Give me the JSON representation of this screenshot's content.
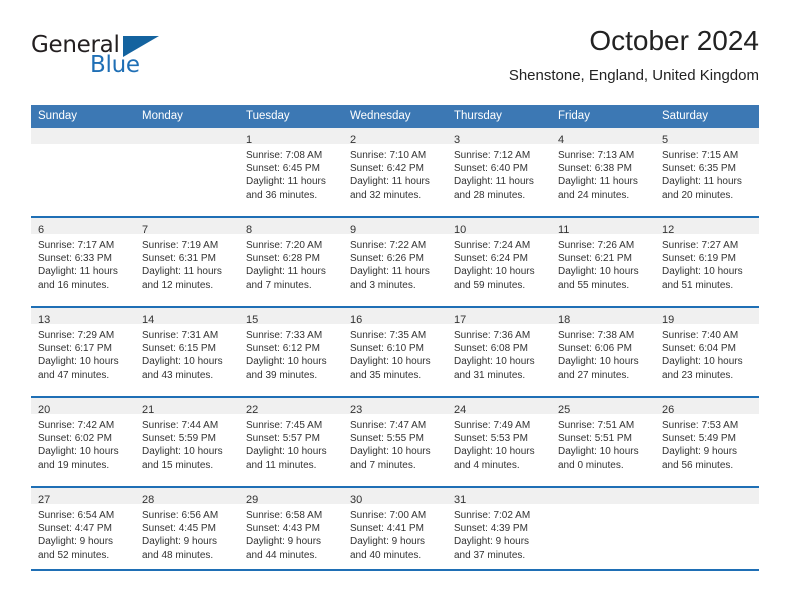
{
  "brand": {
    "name_part1": "General",
    "name_part2": "Blue",
    "flag_icon": "triangle-flag-icon",
    "accent_color": "#1f6fb5"
  },
  "header": {
    "title": "October 2024",
    "location": "Shenstone, England, United Kingdom"
  },
  "colors": {
    "header_row_bg": "#3c78b4",
    "daynum_band_bg": "#f0f0f0",
    "separator": "#1f6fb5",
    "text": "#333333"
  },
  "weekday_headers": [
    "Sunday",
    "Monday",
    "Tuesday",
    "Wednesday",
    "Thursday",
    "Friday",
    "Saturday"
  ],
  "weeks": [
    [
      {
        "day": "",
        "lines": []
      },
      {
        "day": "",
        "lines": []
      },
      {
        "day": "1",
        "lines": [
          "Sunrise: 7:08 AM",
          "Sunset: 6:45 PM",
          "Daylight: 11 hours",
          "and 36 minutes."
        ]
      },
      {
        "day": "2",
        "lines": [
          "Sunrise: 7:10 AM",
          "Sunset: 6:42 PM",
          "Daylight: 11 hours",
          "and 32 minutes."
        ]
      },
      {
        "day": "3",
        "lines": [
          "Sunrise: 7:12 AM",
          "Sunset: 6:40 PM",
          "Daylight: 11 hours",
          "and 28 minutes."
        ]
      },
      {
        "day": "4",
        "lines": [
          "Sunrise: 7:13 AM",
          "Sunset: 6:38 PM",
          "Daylight: 11 hours",
          "and 24 minutes."
        ]
      },
      {
        "day": "5",
        "lines": [
          "Sunrise: 7:15 AM",
          "Sunset: 6:35 PM",
          "Daylight: 11 hours",
          "and 20 minutes."
        ]
      }
    ],
    [
      {
        "day": "6",
        "lines": [
          "Sunrise: 7:17 AM",
          "Sunset: 6:33 PM",
          "Daylight: 11 hours",
          "and 16 minutes."
        ]
      },
      {
        "day": "7",
        "lines": [
          "Sunrise: 7:19 AM",
          "Sunset: 6:31 PM",
          "Daylight: 11 hours",
          "and 12 minutes."
        ]
      },
      {
        "day": "8",
        "lines": [
          "Sunrise: 7:20 AM",
          "Sunset: 6:28 PM",
          "Daylight: 11 hours",
          "and 7 minutes."
        ]
      },
      {
        "day": "9",
        "lines": [
          "Sunrise: 7:22 AM",
          "Sunset: 6:26 PM",
          "Daylight: 11 hours",
          "and 3 minutes."
        ]
      },
      {
        "day": "10",
        "lines": [
          "Sunrise: 7:24 AM",
          "Sunset: 6:24 PM",
          "Daylight: 10 hours",
          "and 59 minutes."
        ]
      },
      {
        "day": "11",
        "lines": [
          "Sunrise: 7:26 AM",
          "Sunset: 6:21 PM",
          "Daylight: 10 hours",
          "and 55 minutes."
        ]
      },
      {
        "day": "12",
        "lines": [
          "Sunrise: 7:27 AM",
          "Sunset: 6:19 PM",
          "Daylight: 10 hours",
          "and 51 minutes."
        ]
      }
    ],
    [
      {
        "day": "13",
        "lines": [
          "Sunrise: 7:29 AM",
          "Sunset: 6:17 PM",
          "Daylight: 10 hours",
          "and 47 minutes."
        ]
      },
      {
        "day": "14",
        "lines": [
          "Sunrise: 7:31 AM",
          "Sunset: 6:15 PM",
          "Daylight: 10 hours",
          "and 43 minutes."
        ]
      },
      {
        "day": "15",
        "lines": [
          "Sunrise: 7:33 AM",
          "Sunset: 6:12 PM",
          "Daylight: 10 hours",
          "and 39 minutes."
        ]
      },
      {
        "day": "16",
        "lines": [
          "Sunrise: 7:35 AM",
          "Sunset: 6:10 PM",
          "Daylight: 10 hours",
          "and 35 minutes."
        ]
      },
      {
        "day": "17",
        "lines": [
          "Sunrise: 7:36 AM",
          "Sunset: 6:08 PM",
          "Daylight: 10 hours",
          "and 31 minutes."
        ]
      },
      {
        "day": "18",
        "lines": [
          "Sunrise: 7:38 AM",
          "Sunset: 6:06 PM",
          "Daylight: 10 hours",
          "and 27 minutes."
        ]
      },
      {
        "day": "19",
        "lines": [
          "Sunrise: 7:40 AM",
          "Sunset: 6:04 PM",
          "Daylight: 10 hours",
          "and 23 minutes."
        ]
      }
    ],
    [
      {
        "day": "20",
        "lines": [
          "Sunrise: 7:42 AM",
          "Sunset: 6:02 PM",
          "Daylight: 10 hours",
          "and 19 minutes."
        ]
      },
      {
        "day": "21",
        "lines": [
          "Sunrise: 7:44 AM",
          "Sunset: 5:59 PM",
          "Daylight: 10 hours",
          "and 15 minutes."
        ]
      },
      {
        "day": "22",
        "lines": [
          "Sunrise: 7:45 AM",
          "Sunset: 5:57 PM",
          "Daylight: 10 hours",
          "and 11 minutes."
        ]
      },
      {
        "day": "23",
        "lines": [
          "Sunrise: 7:47 AM",
          "Sunset: 5:55 PM",
          "Daylight: 10 hours",
          "and 7 minutes."
        ]
      },
      {
        "day": "24",
        "lines": [
          "Sunrise: 7:49 AM",
          "Sunset: 5:53 PM",
          "Daylight: 10 hours",
          "and 4 minutes."
        ]
      },
      {
        "day": "25",
        "lines": [
          "Sunrise: 7:51 AM",
          "Sunset: 5:51 PM",
          "Daylight: 10 hours",
          "and 0 minutes."
        ]
      },
      {
        "day": "26",
        "lines": [
          "Sunrise: 7:53 AM",
          "Sunset: 5:49 PM",
          "Daylight: 9 hours",
          "and 56 minutes."
        ]
      }
    ],
    [
      {
        "day": "27",
        "lines": [
          "Sunrise: 6:54 AM",
          "Sunset: 4:47 PM",
          "Daylight: 9 hours",
          "and 52 minutes."
        ]
      },
      {
        "day": "28",
        "lines": [
          "Sunrise: 6:56 AM",
          "Sunset: 4:45 PM",
          "Daylight: 9 hours",
          "and 48 minutes."
        ]
      },
      {
        "day": "29",
        "lines": [
          "Sunrise: 6:58 AM",
          "Sunset: 4:43 PM",
          "Daylight: 9 hours",
          "and 44 minutes."
        ]
      },
      {
        "day": "30",
        "lines": [
          "Sunrise: 7:00 AM",
          "Sunset: 4:41 PM",
          "Daylight: 9 hours",
          "and 40 minutes."
        ]
      },
      {
        "day": "31",
        "lines": [
          "Sunrise: 7:02 AM",
          "Sunset: 4:39 PM",
          "Daylight: 9 hours",
          "and 37 minutes."
        ]
      },
      {
        "day": "",
        "lines": []
      },
      {
        "day": "",
        "lines": []
      }
    ]
  ]
}
